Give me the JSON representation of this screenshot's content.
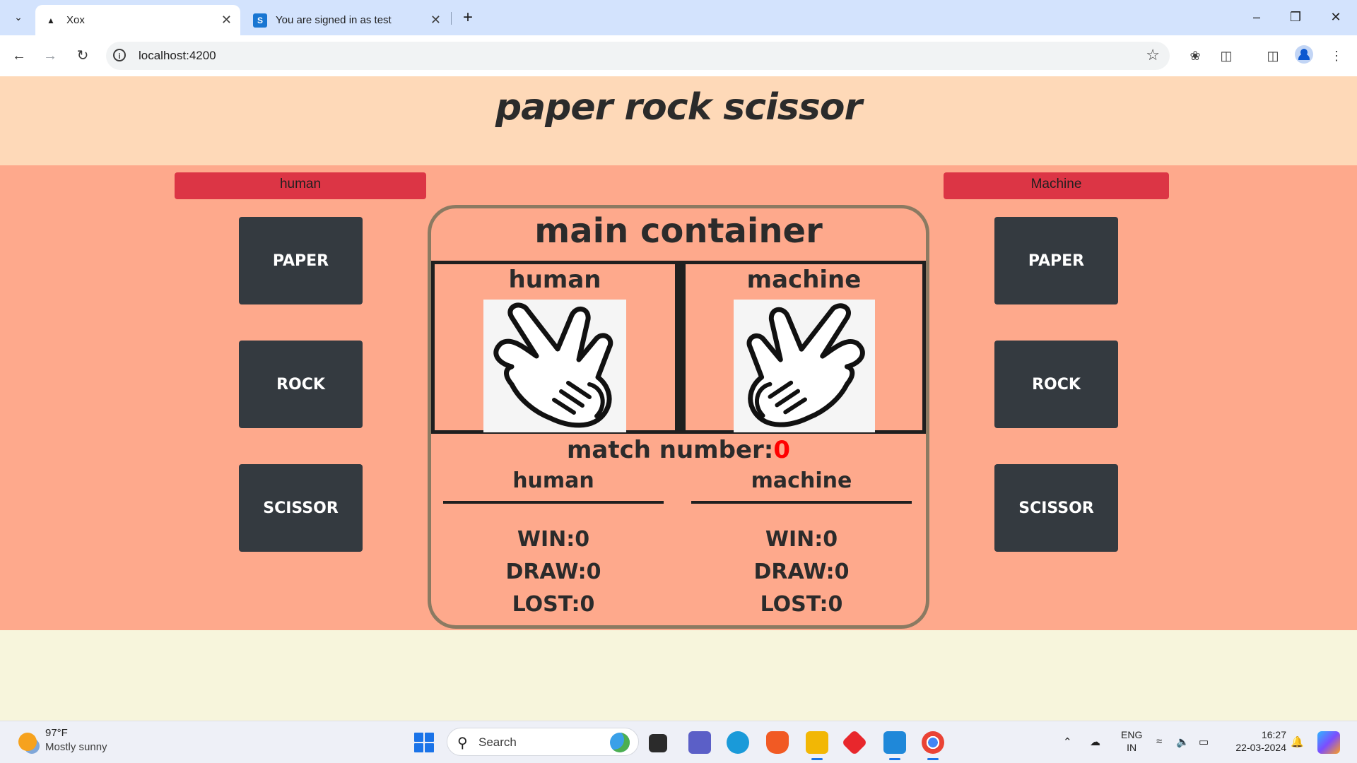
{
  "browser": {
    "tabs": [
      {
        "title": "Xox",
        "active": true,
        "favicon": "angular-icon"
      },
      {
        "title": "You are signed in as test",
        "active": false,
        "favicon": "s-icon"
      }
    ],
    "new_tab": "+",
    "url": "localhost:4200"
  },
  "page": {
    "title": "paper rock scissor",
    "human_label": "human",
    "machine_label": "Machine",
    "human_buttons": [
      "PAPER",
      "ROCK",
      "SCISSOR"
    ],
    "machine_buttons": [
      "PAPER",
      "ROCK",
      "SCISSOR"
    ],
    "main": {
      "title": "main container",
      "human_hand_label": "human",
      "machine_hand_label": "machine",
      "match_label": "match number:",
      "match_value": "0",
      "human_score": {
        "header": "human",
        "win": "WIN:0",
        "draw": "DRAW:0",
        "lost": "LOST:0"
      },
      "machine_score": {
        "header": "machine",
        "win": "WIN:0",
        "draw": "DRAW:0",
        "lost": "LOST:0"
      }
    }
  },
  "taskbar": {
    "weather_temp": "97°F",
    "weather_desc": "Mostly sunny",
    "search_placeholder": "Search",
    "lang_line1": "ENG",
    "lang_line2": "IN",
    "time": "16:27",
    "date": "22-03-2024"
  },
  "colors": {
    "header_bg": "#fed9b8",
    "game_bg": "#fea98c",
    "label_red": "#dc3545",
    "button_dark": "#343a40",
    "match_red": "#ff0000"
  }
}
